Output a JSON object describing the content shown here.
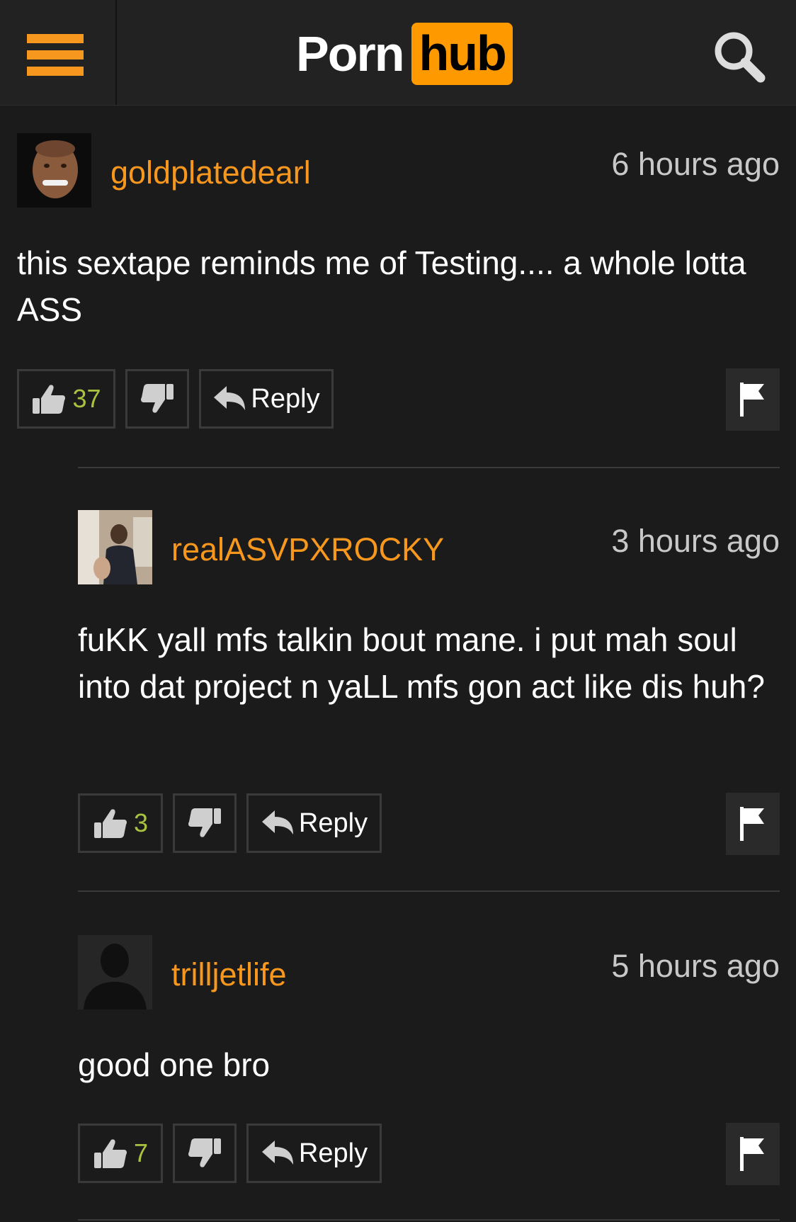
{
  "header": {
    "logo_left": "Porn",
    "logo_right": "hub"
  },
  "comments": [
    {
      "username": "goldplatedearl",
      "time": "6 hours ago",
      "text": "this sextape reminds me of Testing.... a whole lotta ASS",
      "likes": "37",
      "reply_label": "Reply"
    },
    {
      "username": "realASVPXROCKY",
      "time": "3 hours ago",
      "text": "fuKK yall mfs talkin bout mane. i put mah soul into dat project n yaLL mfs gon act like dis huh?",
      "likes": "3",
      "reply_label": "Reply"
    },
    {
      "username": "trilljetlife",
      "time": "5 hours ago",
      "text": "good one bro",
      "likes": "7",
      "reply_label": "Reply"
    }
  ],
  "colors": {
    "accent": "#f7971e",
    "logo_orange": "#ff9900",
    "like_count": "#a9c23f",
    "background": "#1b1b1b"
  }
}
